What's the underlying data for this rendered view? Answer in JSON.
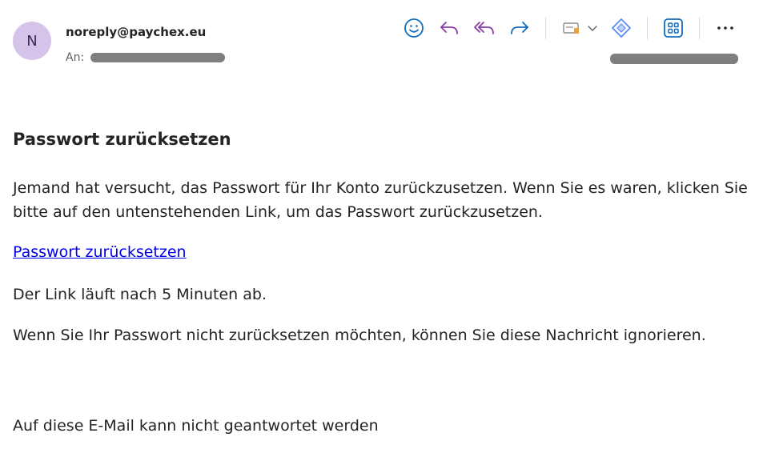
{
  "header": {
    "avatar_initial": "N",
    "sender": "noreply@paychex.eu",
    "to_label": "An:",
    "icons": [
      "smiley-icon",
      "reply-icon",
      "reply-all-icon",
      "forward-icon",
      "mail-tag-icon",
      "chevron-down-icon",
      "immersive-reader-icon",
      "apps-icon",
      "more-icon"
    ]
  },
  "message": {
    "heading": "Passwort zurücksetzen",
    "paragraph1": "Jemand hat versucht, das Passwort für Ihr Konto zurückzusetzen. Wenn Sie es waren, klicken Sie bitte auf den untenstehenden Link, um das Passwort zurückzusetzen.",
    "link_text": "Passwort zurücksetzen",
    "paragraph2": "Der Link läuft nach 5 Minuten ab.",
    "paragraph3": "Wenn Sie Ihr Passwort nicht zurücksetzen möchten, können Sie diese Nachricht ignorieren.",
    "footer": "Auf diese E-Mail kann nicht geantwortet werden"
  },
  "colors": {
    "avatar_bg": "#d5c3ea",
    "icon_blue": "#0f6cbd",
    "icon_purple": "#8a3ba8",
    "link": "#0000ee"
  }
}
